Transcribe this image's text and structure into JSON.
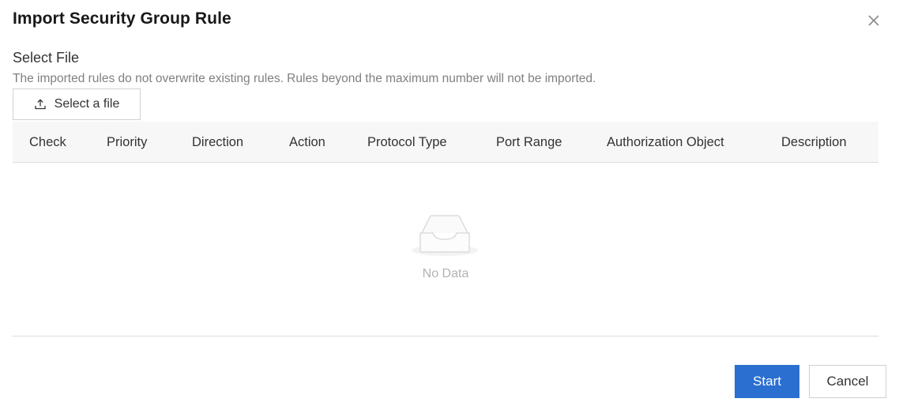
{
  "dialog": {
    "title": "Import Security Group Rule",
    "close_icon": "close-icon"
  },
  "select_file": {
    "label": "Select File",
    "hint": "The imported rules do not overwrite existing rules. Rules beyond the maximum number will not be imported.",
    "button_label": "Select a file",
    "button_icon": "upload-icon"
  },
  "table": {
    "columns": [
      "Check",
      "Priority",
      "Direction",
      "Action",
      "Protocol Type",
      "Port Range",
      "Authorization Object",
      "Description"
    ],
    "rows": [],
    "empty_text": "No Data",
    "empty_icon": "empty-inbox-icon"
  },
  "footer": {
    "start_label": "Start",
    "cancel_label": "Cancel"
  },
  "colors": {
    "primary": "#2b6fd0",
    "header_bg": "#f7f7f7",
    "hint_text": "#808080"
  }
}
